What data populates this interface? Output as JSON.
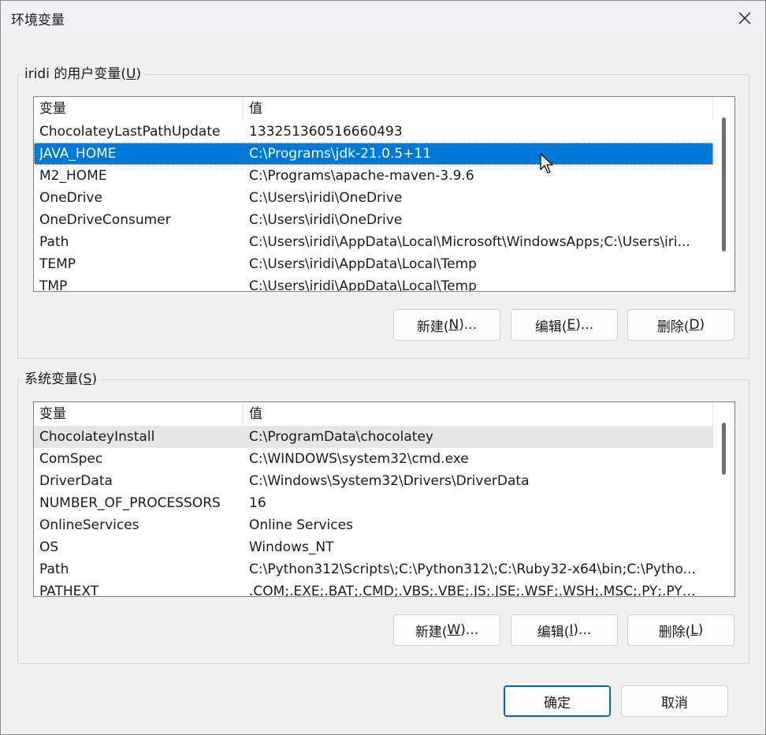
{
  "window": {
    "title": "环境变量"
  },
  "user_vars": {
    "label_prefix": "iridi 的用户变量(",
    "label_key": "U",
    "label_suffix": ")",
    "columns": {
      "name": "变量",
      "value": "值"
    },
    "rows": [
      {
        "name": "ChocolateyLastPathUpdate",
        "value": "133251360516660493"
      },
      {
        "name": "JAVA_HOME",
        "value": "C:\\Programs\\jdk-21.0.5+11"
      },
      {
        "name": "M2_HOME",
        "value": "C:\\Programs\\apache-maven-3.9.6"
      },
      {
        "name": "OneDrive",
        "value": "C:\\Users\\iridi\\OneDrive"
      },
      {
        "name": "OneDriveConsumer",
        "value": "C:\\Users\\iridi\\OneDrive"
      },
      {
        "name": "Path",
        "value": "C:\\Users\\iridi\\AppData\\Local\\Microsoft\\WindowsApps;C:\\Users\\iri..."
      },
      {
        "name": "TEMP",
        "value": "C:\\Users\\iridi\\AppData\\Local\\Temp"
      },
      {
        "name": "TMP",
        "value": "C:\\Users\\iridi\\AppData\\Local\\Temp"
      }
    ],
    "selected_row": "JAVA_HOME",
    "buttons": {
      "new_pre": "新建(",
      "new_key": "N",
      "new_post": ")...",
      "edit_pre": "编辑(",
      "edit_key": "E",
      "edit_post": ")...",
      "delete_pre": "删除(",
      "delete_key": "D",
      "delete_post": ")"
    }
  },
  "system_vars": {
    "label_prefix": "系统变量(",
    "label_key": "S",
    "label_suffix": ")",
    "columns": {
      "name": "变量",
      "value": "值"
    },
    "rows": [
      {
        "name": "ChocolateyInstall",
        "value": "C:\\ProgramData\\chocolatey"
      },
      {
        "name": "ComSpec",
        "value": "C:\\WINDOWS\\system32\\cmd.exe"
      },
      {
        "name": "DriverData",
        "value": "C:\\Windows\\System32\\Drivers\\DriverData"
      },
      {
        "name": "NUMBER_OF_PROCESSORS",
        "value": "16"
      },
      {
        "name": "OnlineServices",
        "value": "Online Services"
      },
      {
        "name": "OS",
        "value": "Windows_NT"
      },
      {
        "name": "Path",
        "value": "C:\\Python312\\Scripts\\;C:\\Python312\\;C:\\Ruby32-x64\\bin;C:\\Pytho..."
      },
      {
        "name": "PATHEXT",
        "value": ".COM;.EXE;.BAT;.CMD;.VBS;.VBE;.JS;.JSE;.WSF;.WSH;.MSC;.PY;.PYW;.R"
      }
    ],
    "hover_row": "ChocolateyInstall",
    "buttons": {
      "new_pre": "新建(",
      "new_key": "W",
      "new_post": ")...",
      "edit_pre": "编辑(",
      "edit_key": "I",
      "edit_post": ")...",
      "delete_pre": "删除(",
      "delete_key": "L",
      "delete_post": ")"
    }
  },
  "footer": {
    "ok": "确定",
    "cancel": "取消"
  },
  "colors": {
    "selection": "#0078d7",
    "hover": "#e5e5e5",
    "primary_border": "#0067c0"
  },
  "icons": [
    "close-icon",
    "mouse-cursor-icon"
  ]
}
